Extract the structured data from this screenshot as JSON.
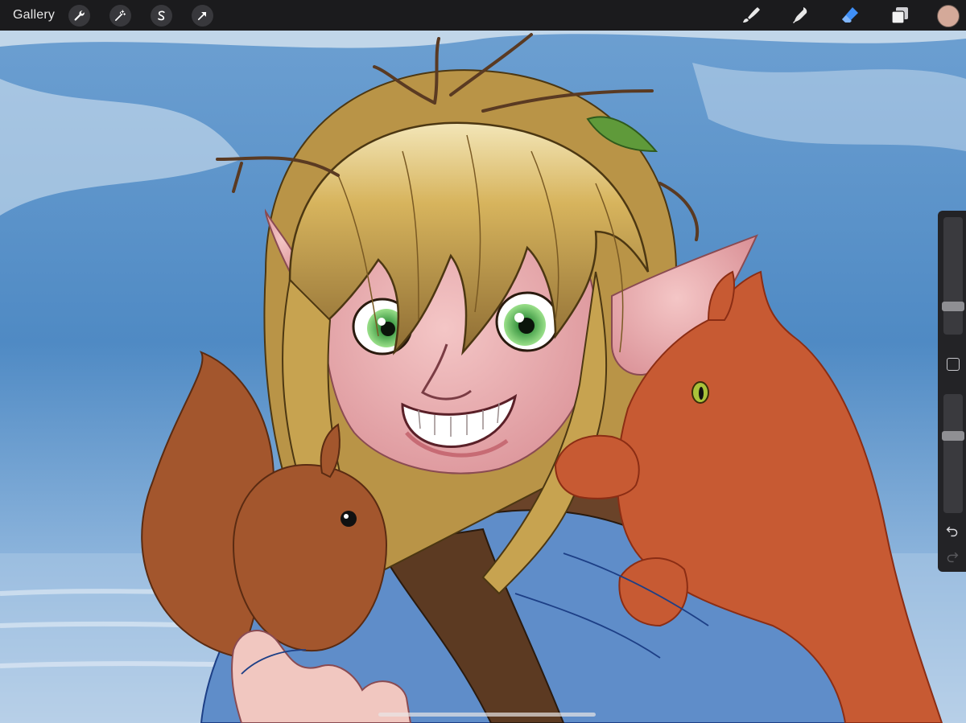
{
  "topbar": {
    "gallery_label": "Gallery",
    "left_tools": [
      {
        "name": "actions-wrench-icon"
      },
      {
        "name": "adjustments-magic-wand-icon"
      },
      {
        "name": "selection-s-icon"
      },
      {
        "name": "transform-arrow-icon"
      }
    ],
    "right_tools": [
      {
        "name": "brush-icon"
      },
      {
        "name": "smudge-icon"
      },
      {
        "name": "eraser-icon",
        "active": true
      },
      {
        "name": "layers-icon"
      }
    ],
    "current_color": "#d4a999"
  },
  "sidebar": {
    "brush_size_icon": "brush-size-slider",
    "opacity_icon": "opacity-slider",
    "modifier_icon": "square-modifier-icon",
    "undo_icon": "undo-arrow-icon",
    "redo_icon": "redo-arrow-icon"
  },
  "colors": {
    "accent": "#3f8ff7",
    "toolbar_bg": "#1b1b1d",
    "sky": "#4f8ac4",
    "hair": "#d4b25a",
    "shirt": "#5f8dc9",
    "squirrel": "#a3562d",
    "fox": "#c75a33"
  }
}
